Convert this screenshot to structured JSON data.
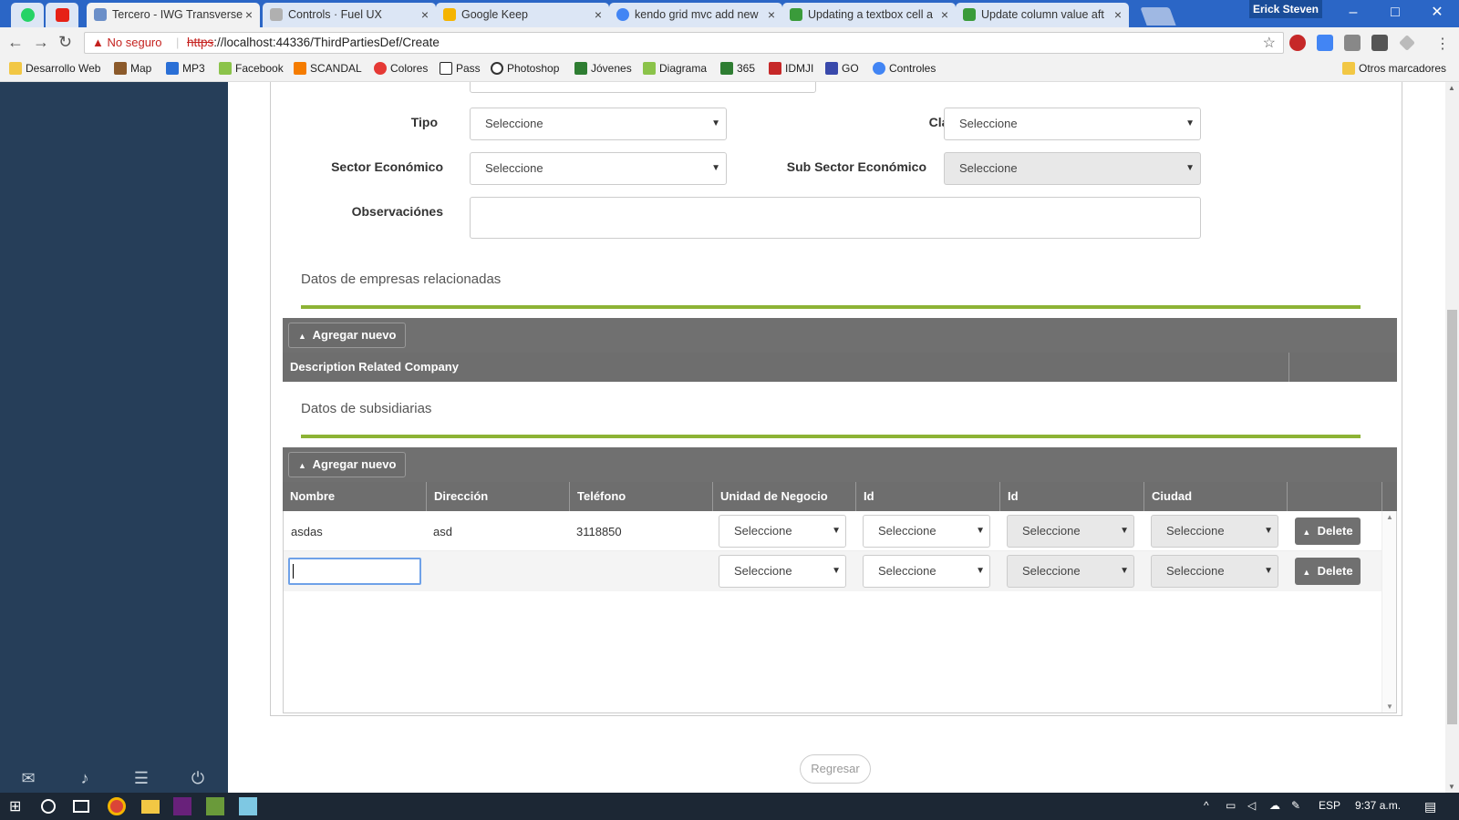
{
  "window": {
    "profile_name": "Erick Steven",
    "minimize": "–",
    "maximize": "□",
    "close": "✕"
  },
  "tabs": [
    {
      "label": "Tercero - IWG Transverse",
      "active": true,
      "icon_color": "#6b8fc8"
    },
    {
      "label": "Controls · Fuel UX",
      "active": false,
      "icon_color": "#b0b0b0"
    },
    {
      "label": "Google Keep",
      "active": false,
      "icon_color": "#f5b400"
    },
    {
      "label": "kendo grid mvc add new",
      "active": false,
      "icon_color": "#4285f4"
    },
    {
      "label": "Updating a textbox cell a",
      "active": false,
      "icon_color": "#3a9b3a"
    },
    {
      "label": "Update column value aft",
      "active": false,
      "icon_color": "#3a9b3a"
    }
  ],
  "address": {
    "security": "No seguro",
    "scheme": "https",
    "url_rest": "://localhost:44336/ThirdPartiesDef/Create"
  },
  "bookmarks": [
    {
      "label": "Desarrollo Web",
      "color": "#f2c744"
    },
    {
      "label": "Map",
      "color": "#8b5a2b"
    },
    {
      "label": "MP3",
      "color": "#2a6fd6"
    },
    {
      "label": "Facebook",
      "color": "#8bc34a"
    },
    {
      "label": "SCANDAL",
      "color": "#f57c00"
    },
    {
      "label": "Colores",
      "color": "#e53935"
    },
    {
      "label": "Pass",
      "color": "#222222"
    },
    {
      "label": "Photoshop",
      "color": "#333333"
    },
    {
      "label": "Jóvenes",
      "color": "#2e7d32"
    },
    {
      "label": "Diagrama",
      "color": "#8bc34a"
    },
    {
      "label": "365",
      "color": "#2e7d32"
    },
    {
      "label": "IDMJI",
      "color": "#c62828"
    },
    {
      "label": "GO",
      "color": "#3949ab"
    },
    {
      "label": "Controles",
      "color": "#4285f4"
    }
  ],
  "other_bookmarks": "Otros marcadores",
  "form": {
    "tipo_label": "Tipo",
    "tipo_value": "Seleccione",
    "clase_label": "Clase",
    "clase_value": "Seleccione",
    "sector_label": "Sector Económico",
    "sector_value": "Seleccione",
    "subsector_label": "Sub Sector Económico",
    "subsector_value": "Seleccione",
    "obs_label": "Observaciónes"
  },
  "related": {
    "title": "Datos de empresas relacionadas",
    "add_label": "Agregar nuevo",
    "column": "Description Related Company"
  },
  "subsidiaries": {
    "title": "Datos de subsidiarias",
    "add_label": "Agregar nuevo",
    "columns": [
      "Nombre",
      "Dirección",
      "Teléfono",
      "Unidad de Negocio",
      "Id",
      "Id",
      "Ciudad"
    ],
    "rows": [
      {
        "nombre": "asdas",
        "direccion": "asd",
        "telefono": "3118850",
        "unidad": "Seleccione",
        "id1": "Seleccione",
        "id2": "Seleccione",
        "ciudad": "Seleccione",
        "delete": "Delete"
      },
      {
        "nombre": "",
        "direccion": "",
        "telefono": "",
        "unidad": "Seleccione",
        "id1": "Seleccione",
        "id2": "Seleccione",
        "ciudad": "Seleccione",
        "delete": "Delete"
      }
    ]
  },
  "footer": {
    "back": "Regresar"
  },
  "tray": {
    "lang": "ESP",
    "time": "9:37 a.m."
  }
}
